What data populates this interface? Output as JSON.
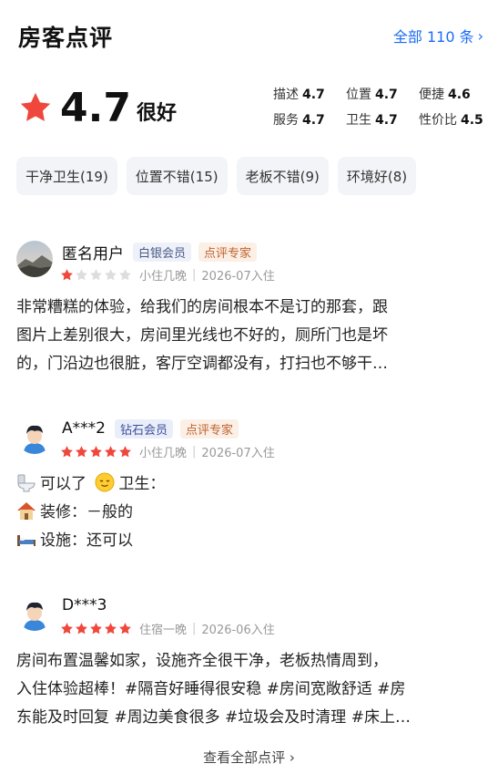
{
  "header": {
    "title": "房客点评",
    "all_link": "全部 110 条",
    "chevron": "›"
  },
  "score": {
    "value": "4.7",
    "word": "很好",
    "star_color": "#f0473d"
  },
  "subscores": [
    {
      "label": "描述",
      "value": "4.7"
    },
    {
      "label": "位置",
      "value": "4.7"
    },
    {
      "label": "便捷",
      "value": "4.6"
    },
    {
      "label": "服务",
      "value": "4.7"
    },
    {
      "label": "卫生",
      "value": "4.7"
    },
    {
      "label": "性价比",
      "value": "4.5"
    }
  ],
  "tags": [
    "干净卫生(19)",
    "位置不错(15)",
    "老板不错(9)",
    "环境好(8)"
  ],
  "reviews": [
    {
      "name": "匿名用户",
      "member": "白银会员",
      "expert": "点评专家",
      "rating": 1,
      "stay": "小住几晚",
      "date": "2026-07入住",
      "lines": [
        "非常糟糕的体验，给我们的房间根本不是订的那套，跟",
        "图片上差别很大，房间里光线也不好的，厕所门也是坏",
        "的，门沿边也很脏，客厅空调都没有，打扫也不够干…"
      ]
    },
    {
      "name": "A***2",
      "member": "钻石会员",
      "expert": "点评专家",
      "rating": 5,
      "stay": "小住几晚",
      "date": "2026-07入住",
      "lines": [
        "可以了",
        "卫生：",
        "装修：－般的",
        "设施：还可以"
      ],
      "icons": [
        "toilet-icon",
        "relieved-face-icon",
        "house-icon",
        "bed-icon"
      ]
    },
    {
      "name": "D***3",
      "member": "",
      "expert": "",
      "rating": 5,
      "stay": "住宿一晚",
      "date": "2026-06入住",
      "lines": [
        "房间布置温馨如家，设施齐全很干净，老板热情周到，",
        "入住体验超棒！#隔音好睡得很安稳 #房间宽敞舒适 #房",
        "东能及时回复 #周边美食很多 #垃圾会及时清理 #床上…"
      ]
    }
  ],
  "footer": {
    "label": "查看全部点评",
    "chevron": "›"
  },
  "colors": {
    "accent": "#1a6cf5",
    "star_on": "#f0473d",
    "star_off": "#dddddd"
  }
}
